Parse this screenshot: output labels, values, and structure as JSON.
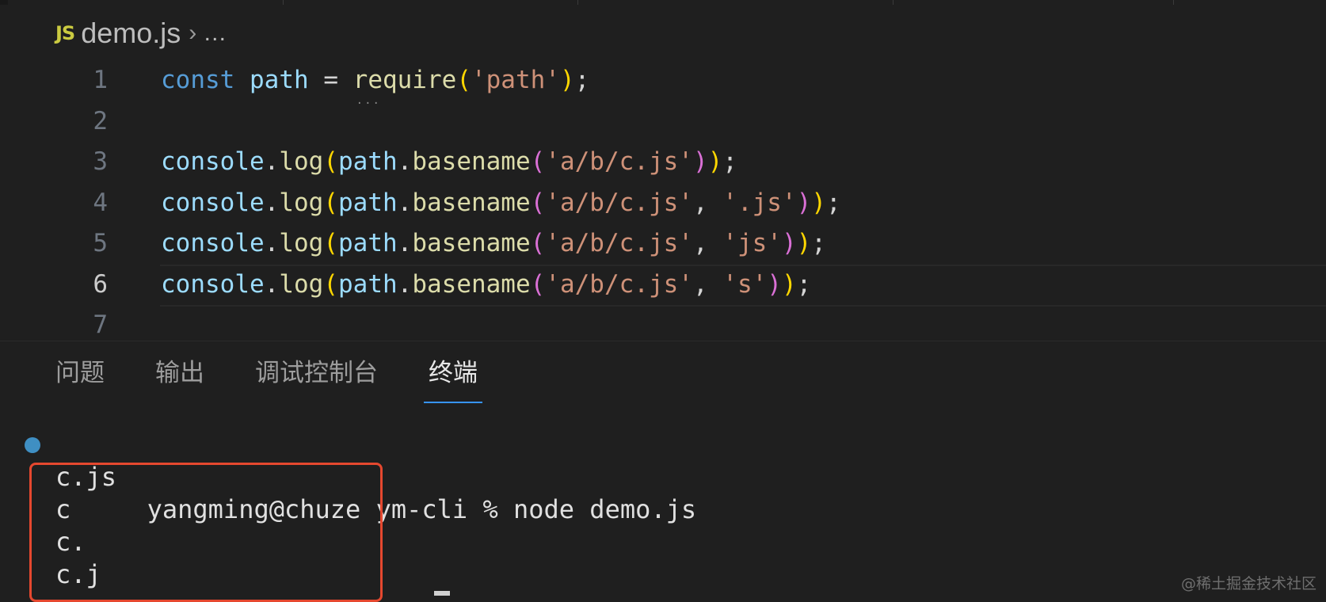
{
  "breadcrumb": {
    "icon": "JS",
    "file": "demo.js",
    "separator": "›",
    "more": "…"
  },
  "editor": {
    "lines": [
      {
        "num": "1",
        "tokens": [
          {
            "t": "const",
            "c": "kw"
          },
          {
            "t": " ",
            "c": "pun"
          },
          {
            "t": "path",
            "c": "var"
          },
          {
            "t": " = ",
            "c": "pun"
          },
          {
            "t": "require",
            "c": "fn",
            "squiggle": true
          },
          {
            "t": "(",
            "c": "p1"
          },
          {
            "t": "'path'",
            "c": "str"
          },
          {
            "t": ")",
            "c": "p1"
          },
          {
            "t": ";",
            "c": "pun"
          }
        ]
      },
      {
        "num": "2",
        "tokens": []
      },
      {
        "num": "3",
        "tokens": [
          {
            "t": "console",
            "c": "var"
          },
          {
            "t": ".",
            "c": "pun"
          },
          {
            "t": "log",
            "c": "fn"
          },
          {
            "t": "(",
            "c": "p1"
          },
          {
            "t": "path",
            "c": "var"
          },
          {
            "t": ".",
            "c": "pun"
          },
          {
            "t": "basename",
            "c": "fn"
          },
          {
            "t": "(",
            "c": "p2"
          },
          {
            "t": "'a/b/c.js'",
            "c": "str"
          },
          {
            "t": ")",
            "c": "p2"
          },
          {
            "t": ")",
            "c": "p1"
          },
          {
            "t": ";",
            "c": "pun"
          }
        ]
      },
      {
        "num": "4",
        "tokens": [
          {
            "t": "console",
            "c": "var"
          },
          {
            "t": ".",
            "c": "pun"
          },
          {
            "t": "log",
            "c": "fn"
          },
          {
            "t": "(",
            "c": "p1"
          },
          {
            "t": "path",
            "c": "var"
          },
          {
            "t": ".",
            "c": "pun"
          },
          {
            "t": "basename",
            "c": "fn"
          },
          {
            "t": "(",
            "c": "p2"
          },
          {
            "t": "'a/b/c.js'",
            "c": "str"
          },
          {
            "t": ", ",
            "c": "pun"
          },
          {
            "t": "'.js'",
            "c": "str"
          },
          {
            "t": ")",
            "c": "p2"
          },
          {
            "t": ")",
            "c": "p1"
          },
          {
            "t": ";",
            "c": "pun"
          }
        ]
      },
      {
        "num": "5",
        "tokens": [
          {
            "t": "console",
            "c": "var"
          },
          {
            "t": ".",
            "c": "pun"
          },
          {
            "t": "log",
            "c": "fn"
          },
          {
            "t": "(",
            "c": "p1"
          },
          {
            "t": "path",
            "c": "var"
          },
          {
            "t": ".",
            "c": "pun"
          },
          {
            "t": "basename",
            "c": "fn"
          },
          {
            "t": "(",
            "c": "p2"
          },
          {
            "t": "'a/b/c.js'",
            "c": "str"
          },
          {
            "t": ", ",
            "c": "pun"
          },
          {
            "t": "'js'",
            "c": "str"
          },
          {
            "t": ")",
            "c": "p2"
          },
          {
            "t": ")",
            "c": "p1"
          },
          {
            "t": ";",
            "c": "pun"
          }
        ]
      },
      {
        "num": "6",
        "current": true,
        "tokens": [
          {
            "t": "console",
            "c": "var"
          },
          {
            "t": ".",
            "c": "pun"
          },
          {
            "t": "log",
            "c": "fn"
          },
          {
            "t": "(",
            "c": "p1"
          },
          {
            "t": "path",
            "c": "var"
          },
          {
            "t": ".",
            "c": "pun"
          },
          {
            "t": "basename",
            "c": "fn"
          },
          {
            "t": "(",
            "c": "p2"
          },
          {
            "t": "'a/b/c.js'",
            "c": "str"
          },
          {
            "t": ", ",
            "c": "pun"
          },
          {
            "t": "'s'",
            "c": "str"
          },
          {
            "t": ")",
            "c": "p2"
          },
          {
            "t": ")",
            "c": "p1"
          },
          {
            "t": ";",
            "c": "pun"
          }
        ]
      },
      {
        "num": "7",
        "tokens": []
      }
    ]
  },
  "panel": {
    "tabs": [
      {
        "label": "问题",
        "active": false
      },
      {
        "label": "输出",
        "active": false
      },
      {
        "label": "调试控制台",
        "active": false
      },
      {
        "label": "终端",
        "active": true
      }
    ]
  },
  "terminal": {
    "prompt": "yangming@chuze ym-cli % node demo.js",
    "output": [
      "c.js",
      "c",
      "c.",
      "c.j"
    ]
  },
  "watermark": "@稀土掘金技术社区",
  "colors": {
    "accent": "#3794ff",
    "highlight_box": "#e5482f",
    "status_dot": "#3f8fc3"
  }
}
